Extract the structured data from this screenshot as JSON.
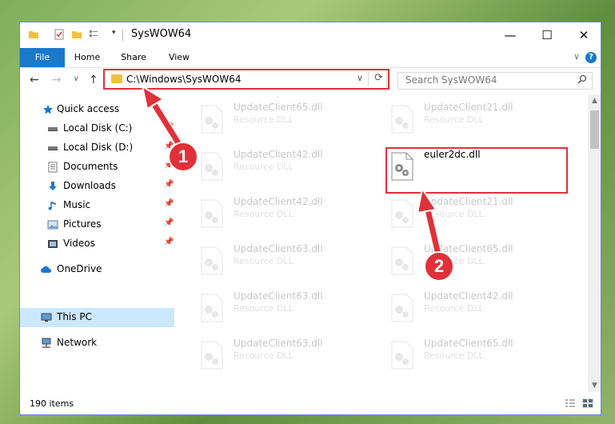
{
  "window": {
    "title": "SysWOW64"
  },
  "ribbon": {
    "tabs": [
      "File",
      "Home",
      "Share",
      "View"
    ],
    "collapse_glyph": "∨",
    "help_glyph": "?"
  },
  "nav": {
    "back_glyph": "←",
    "forward_glyph": "→",
    "recent_glyph": "∨",
    "up_glyph": "↑",
    "address": "C:\\Windows\\SysWOW64",
    "address_chevron": "∨",
    "refresh_glyph": "⟳",
    "search_placeholder": "Search SysWOW64"
  },
  "sidebar": {
    "items": [
      {
        "label": "Quick access",
        "icon": "star-icon"
      },
      {
        "label": "Local Disk (C:)",
        "icon": "drive-icon"
      },
      {
        "label": "Local Disk (D:)",
        "icon": "drive-icon"
      },
      {
        "label": "Documents",
        "icon": "documents-icon"
      },
      {
        "label": "Downloads",
        "icon": "download-icon"
      },
      {
        "label": "Music",
        "icon": "music-icon"
      },
      {
        "label": "Pictures",
        "icon": "pictures-icon"
      },
      {
        "label": "Videos",
        "icon": "videos-icon"
      },
      {
        "label": "OneDrive",
        "icon": "cloud-icon"
      },
      {
        "label": "This PC",
        "icon": "computer-icon"
      },
      {
        "label": "Network",
        "icon": "network-icon"
      }
    ]
  },
  "files": [
    {
      "name": "UpdateClient65.dll",
      "desc": "Resource DLL"
    },
    {
      "name": "UpdateClient21.dll",
      "desc": "Resource DLL"
    },
    {
      "name": "UpdateClient42.dll",
      "desc": "Resource DLL"
    },
    {
      "name": "euler2dc.dll",
      "desc": ""
    },
    {
      "name": "UpdateClient42.dll",
      "desc": "Resource DLL"
    },
    {
      "name": "UpdateClient21.dll",
      "desc": "Resource DLL"
    },
    {
      "name": "UpdateClient63.dll",
      "desc": "Resource DLL"
    },
    {
      "name": "UpdateClient65.dll",
      "desc": "Resource DLL"
    },
    {
      "name": "UpdateClient63.dll",
      "desc": "Resource DLL"
    },
    {
      "name": "UpdateClient42.dll",
      "desc": "Resource DLL"
    },
    {
      "name": "UpdateClient63.dll",
      "desc": "Resource DLL"
    },
    {
      "name": "UpdateClient65.dll",
      "desc": "Resource DLL"
    }
  ],
  "status": {
    "count": "190 items"
  },
  "annotations": {
    "step1": "1",
    "step2": "2",
    "color": "#e0313a"
  },
  "colors": {
    "accent": "#1979ca",
    "selection": "#cce8ff"
  }
}
